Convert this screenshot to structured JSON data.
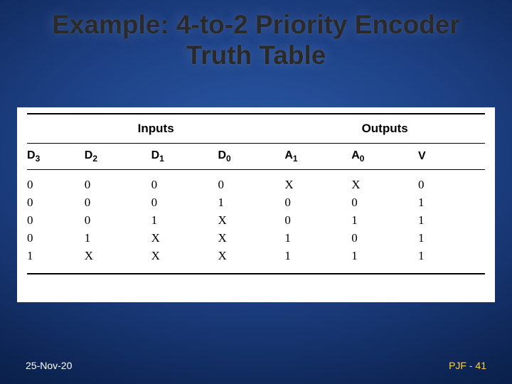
{
  "title_line1": "Example: 4-to-2 Priority Encoder",
  "title_line2": "Truth Table",
  "footer": {
    "date": "25-Nov-20",
    "pageref": "PJF - 41"
  },
  "chart_data": {
    "type": "table",
    "title": "4-to-2 Priority Encoder Truth Table",
    "group_headers": [
      "Inputs",
      "Outputs"
    ],
    "group_spans": {
      "Inputs": 4,
      "Outputs": 3
    },
    "columns": [
      {
        "label": "D",
        "sub": "3"
      },
      {
        "label": "D",
        "sub": "2"
      },
      {
        "label": "D",
        "sub": "1"
      },
      {
        "label": "D",
        "sub": "0"
      },
      {
        "label": "A",
        "sub": "1"
      },
      {
        "label": "A",
        "sub": "0"
      },
      {
        "label": "V",
        "sub": ""
      }
    ],
    "rows": [
      [
        "0",
        "0",
        "0",
        "0",
        "X",
        "X",
        "0"
      ],
      [
        "0",
        "0",
        "0",
        "1",
        "0",
        "0",
        "1"
      ],
      [
        "0",
        "0",
        "1",
        "X",
        "0",
        "1",
        "1"
      ],
      [
        "0",
        "1",
        "X",
        "X",
        "1",
        "0",
        "1"
      ],
      [
        "1",
        "X",
        "X",
        "X",
        "1",
        "1",
        "1"
      ]
    ]
  }
}
